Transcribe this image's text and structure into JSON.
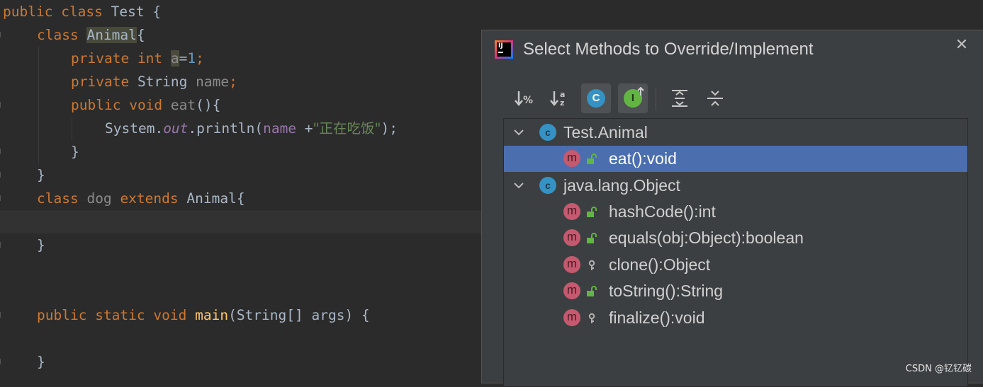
{
  "editor": {
    "lines": {
      "l1": {
        "kw1": "public",
        "kw2": "class",
        "name": "Test",
        "brace": " {"
      },
      "l2": {
        "kw": "class",
        "name": "Animal",
        "brace": "{"
      },
      "l3": {
        "kw1": "private",
        "kw2": "int",
        "field": "a",
        "eq": "=",
        "num": "1",
        "semi": ";"
      },
      "l4": {
        "kw": "private",
        "type": "String",
        "field": "name",
        "semi": ";"
      },
      "l5": {
        "kw1": "public",
        "kw2": "void",
        "method": "eat",
        "rest": "(){"
      },
      "l6": {
        "obj": "System.",
        "static_field": "out",
        "call": ".println(",
        "field": "name",
        "plus": " +",
        "str": "\"正在吃饭\"",
        "end": ");"
      },
      "l7": {
        "text": "}"
      },
      "l8": {
        "text": "}"
      },
      "l9": {
        "kw": "class",
        "name": "dog",
        "kw2": "extends",
        "parent": "Animal",
        "brace": "{"
      },
      "l11": {
        "text": "}"
      },
      "l13": {
        "kw1": "public",
        "kw2": "static",
        "kw3": "void",
        "method": "main",
        "rest": "(String[] args) {"
      },
      "l15": {
        "text": "}"
      }
    }
  },
  "dialog": {
    "logo_text": "IJ",
    "title": "Select Methods to Override/Implement",
    "close_glyph": "✕",
    "toolbar": {
      "sort_visibility_icon": "sort-by-visibility-icon",
      "sort_alpha_icon": "sort-alphabetically-icon",
      "show_classes_glyph": "C",
      "show_interfaces_glyph": "I",
      "expand_all_icon": "expand-all-icon",
      "collapse_all_icon": "collapse-all-icon"
    },
    "tree": {
      "groups": [
        {
          "label": "Test.Animal",
          "icon_glyph": "c",
          "methods": [
            {
              "label": "eat():void",
              "icon_glyph": "m",
              "access": "public",
              "selected": true
            }
          ]
        },
        {
          "label": "java.lang.Object",
          "icon_glyph": "c",
          "methods": [
            {
              "label": "hashCode():int",
              "icon_glyph": "m",
              "access": "public"
            },
            {
              "label": "equals(obj:Object):boolean",
              "icon_glyph": "m",
              "access": "public"
            },
            {
              "label": "clone():Object",
              "icon_glyph": "m",
              "access": "protected"
            },
            {
              "label": "toString():String",
              "icon_glyph": "m",
              "access": "public"
            },
            {
              "label": "finalize():void",
              "icon_glyph": "m",
              "access": "protected"
            }
          ]
        }
      ]
    }
  },
  "watermark": "CSDN @钇钇碳",
  "colors": {
    "editor_bg": "#2b2b2b",
    "keyword": "#cc7832",
    "field": "#9876aa",
    "string": "#6a8759",
    "number": "#6897bb",
    "dialog_bg": "#3c3f41",
    "selection": "#4b6eaf",
    "class_icon": "#3592c4",
    "method_icon": "#c5596f",
    "public_lock": "#62b543"
  }
}
